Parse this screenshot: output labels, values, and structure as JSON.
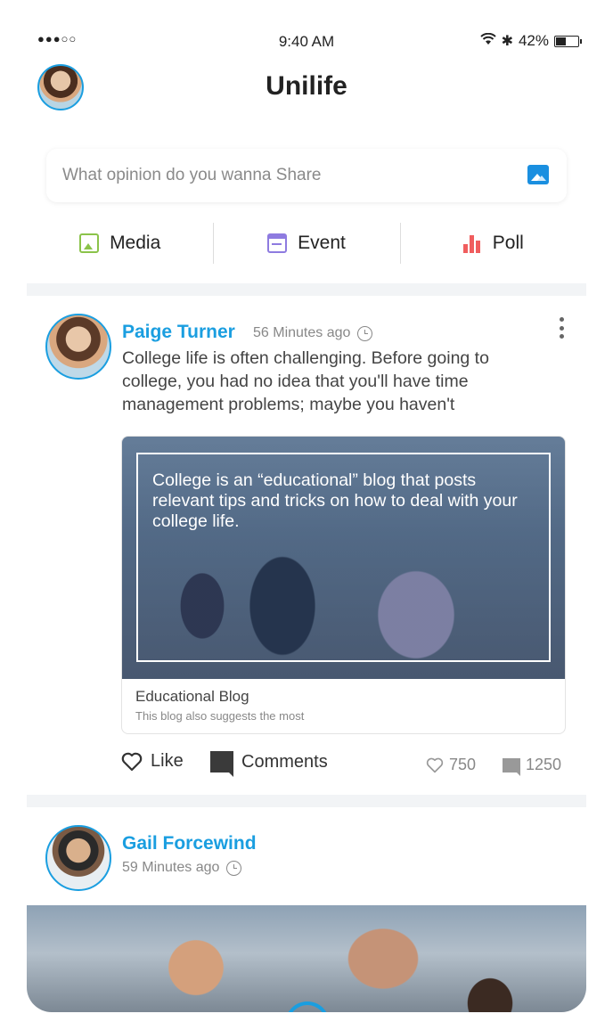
{
  "status_bar": {
    "signal": "●●●○○",
    "time": "9:40 AM",
    "battery_text": "42%",
    "battery_level": 0.42
  },
  "header": {
    "title": "Unilife"
  },
  "composer": {
    "placeholder": "What opinion do you wanna Share",
    "image_icon": "image-icon"
  },
  "actions": [
    {
      "label": "Media",
      "icon": "media-icon",
      "color": "#8bc34a"
    },
    {
      "label": "Event",
      "icon": "calendar-icon",
      "color": "#8e7be0"
    },
    {
      "label": "Poll",
      "icon": "poll-icon",
      "color": "#f05d5e"
    }
  ],
  "post1": {
    "author": "Paige Turner",
    "time_ago": "56 Minutes ago",
    "text": "College life is often challenging. Before going to college, you had no idea that you'll have time management problems; maybe you haven't",
    "card": {
      "quote": "College is an “educational” blog that posts relevant tips and tricks on how to deal with your college life.",
      "title": "Educational Blog",
      "subtitle": "This blog also suggests the most"
    },
    "like_label": "Like",
    "comments_label": "Comments",
    "like_count": "750",
    "comment_count": "1250"
  },
  "post2": {
    "author": "Gail Forcewind",
    "time_ago": "59 Minutes ago"
  },
  "colors": {
    "accent": "#1a9ee0",
    "separator": "#f2f4f6"
  }
}
